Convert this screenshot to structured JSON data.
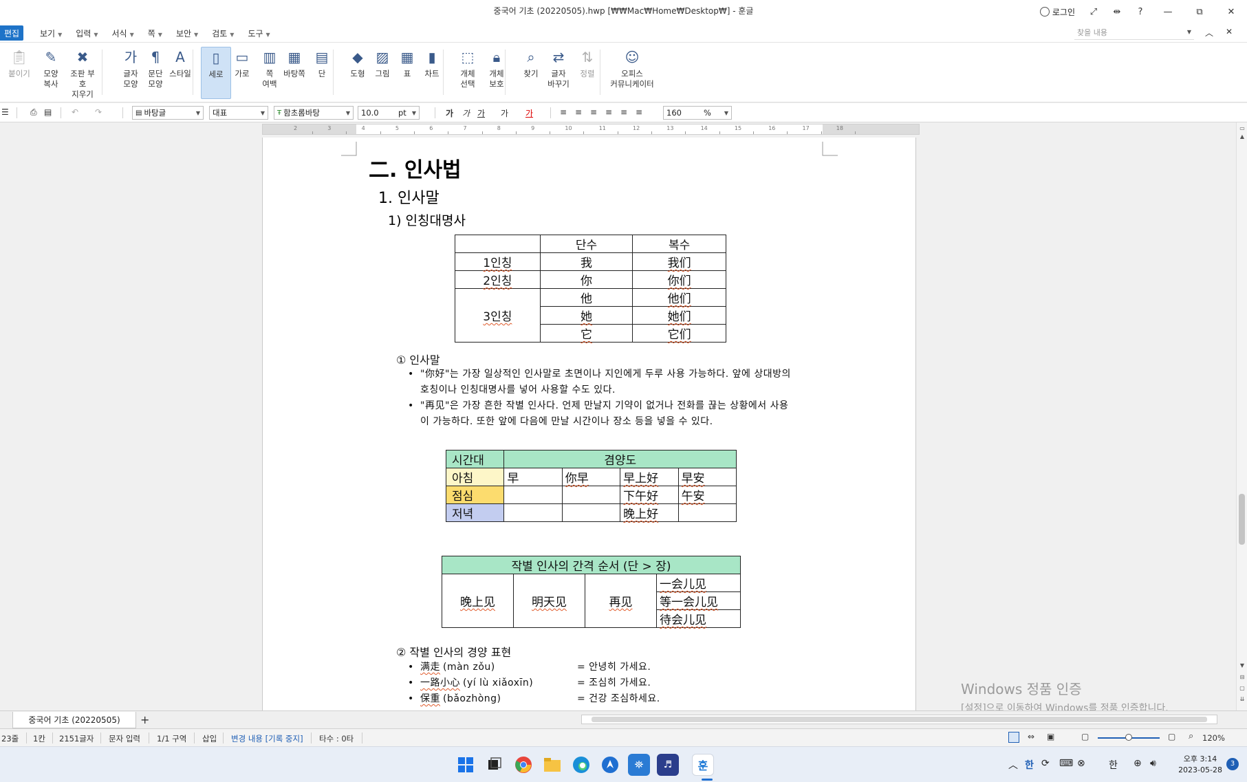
{
  "window": {
    "title": "중국어 기초 (20220505).hwp [₩₩Mac₩Home₩Desktop₩] - 훈글",
    "login_label": "로그인",
    "help_label": "?",
    "minimize": "—",
    "restore": "⧉",
    "close": "✕"
  },
  "menu": {
    "edit_label": "편집",
    "items": [
      "보기",
      "입력",
      "서식",
      "쪽",
      "보안",
      "검토",
      "도구"
    ],
    "find_placeholder": "찾을 내용"
  },
  "ribbon": {
    "buttons": [
      {
        "label": "붙이기",
        "icon": "paste-icon",
        "disabled": true
      },
      {
        "label": "모양\n복사",
        "icon": "format-painter-icon"
      },
      {
        "label": "조판 부호\n지우기",
        "icon": "clear-markup-icon"
      },
      {
        "label": "글자\n모양",
        "icon": "char-shape-icon"
      },
      {
        "label": "문단\n모양",
        "icon": "para-shape-icon"
      },
      {
        "label": "스타일",
        "icon": "style-icon"
      },
      {
        "label": "세로",
        "icon": "portrait-icon",
        "active": true
      },
      {
        "label": "가로",
        "icon": "landscape-icon"
      },
      {
        "label": "쪽\n여백",
        "icon": "page-margin-icon"
      },
      {
        "label": "바탕쪽",
        "icon": "master-page-icon"
      },
      {
        "label": "단",
        "icon": "columns-icon"
      },
      {
        "label": "도형",
        "icon": "shape-icon"
      },
      {
        "label": "그림",
        "icon": "picture-icon"
      },
      {
        "label": "표",
        "icon": "table-icon"
      },
      {
        "label": "차트",
        "icon": "chart-icon"
      },
      {
        "label": "개체\n선택",
        "icon": "object-select-icon"
      },
      {
        "label": "개체\n보호",
        "icon": "object-protect-icon"
      },
      {
        "label": "찾기",
        "icon": "find-icon"
      },
      {
        "label": "글자\n바꾸기",
        "icon": "replace-icon"
      },
      {
        "label": "정렬",
        "icon": "sort-icon",
        "disabled": true
      },
      {
        "label": "오피스\n커뮤니케이터",
        "icon": "office-communicator-icon"
      }
    ]
  },
  "format": {
    "style": "바탕글",
    "language": "대표",
    "font": "함초롬바탕",
    "size": "10.0",
    "size_unit": "pt",
    "zoom": "160",
    "zoom_unit": "%"
  },
  "document": {
    "heading_main": "二. 인사법",
    "heading_1": "1.  인사말",
    "heading_2": "1)  인칭대명사",
    "pronoun_table": {
      "header": [
        "",
        "단수",
        "복수"
      ],
      "rows": [
        [
          "1인칭",
          "我",
          "我们"
        ],
        [
          "2인칭",
          "你",
          "你们"
        ],
        [
          "3인칭",
          "他",
          "他们"
        ],
        [
          "",
          "她",
          "她们"
        ],
        [
          "",
          "它",
          "它们"
        ]
      ]
    },
    "section_a": "①  인사말",
    "bullets_a": [
      "\"你好\"는 가장 일상적인 인사말로 초면이나 지인에게 두루 사용 가능하다. 앞에 상대방의",
      "호칭이나 인칭대명사를 넣어 사용할 수도 있다.",
      "\"再见\"은 가장 흔한 작별 인사다. 언제 만날지 기약이 없거나 전화를 끊는 상황에서 사용",
      "이 가능하다. 또한 앞에 다음에 만날 시간이나 장소 등을 넣을 수 있다."
    ],
    "politeness_table": {
      "header": [
        "시간대",
        "겸양도"
      ],
      "rows": [
        {
          "time": "아침",
          "cells": [
            "早",
            "你早",
            "早上好",
            "早安"
          ]
        },
        {
          "time": "점심",
          "cells": [
            "",
            "",
            "下午好",
            "午安"
          ]
        },
        {
          "time": "저녁",
          "cells": [
            "",
            "",
            "晚上好",
            ""
          ]
        }
      ]
    },
    "farewell_table": {
      "title": "작별 인사의 간격 순서 (단 > 장)",
      "cols": [
        "晚上见",
        "明天见",
        "再见"
      ],
      "last": [
        "一会儿见",
        "等一会儿见",
        "待会儿见"
      ]
    },
    "section_b": "②  작별 인사의 경양 표현",
    "bullets_b": [
      {
        "word": "满走",
        "pinyin": "(màn zǒu)",
        "meaning": "=  안녕히 가세요."
      },
      {
        "word": "一路小心",
        "pinyin": "(yí lù xiǎoxīn)",
        "meaning": "=  조심히 가세요."
      },
      {
        "word": "保重",
        "pinyin": "(bǎozhòng)",
        "meaning": "=  건강 조심하세요."
      }
    ]
  },
  "watermark": {
    "line1": "Windows 정품 인증",
    "line2": "[설정]으로 이동하여 Windows를 정품 인증합니다."
  },
  "tabs": {
    "doc_tab": "중국어 기초 (20220505)",
    "add": "+"
  },
  "status": {
    "line": "23줄",
    "col": "1칸",
    "chars": "2151글자",
    "mode": "문자 입력",
    "section": "1/1 구역",
    "insert": "삽입",
    "track": "변경 내용 [기록 중지]",
    "typing": "타수 : 0타",
    "zoom": "120%"
  },
  "taskbar": {
    "ime1": "한",
    "ime2": "한",
    "time": "오후 3:14",
    "date": "2023-05-28",
    "notif_count": "3"
  },
  "colors": {
    "accent": "#1e73c8",
    "table_header_green": "#a8e6c6",
    "morning_yellow": "#fdf6c8",
    "noon_gold": "#fcdc6e",
    "evening_blue": "#c3cdf0"
  }
}
